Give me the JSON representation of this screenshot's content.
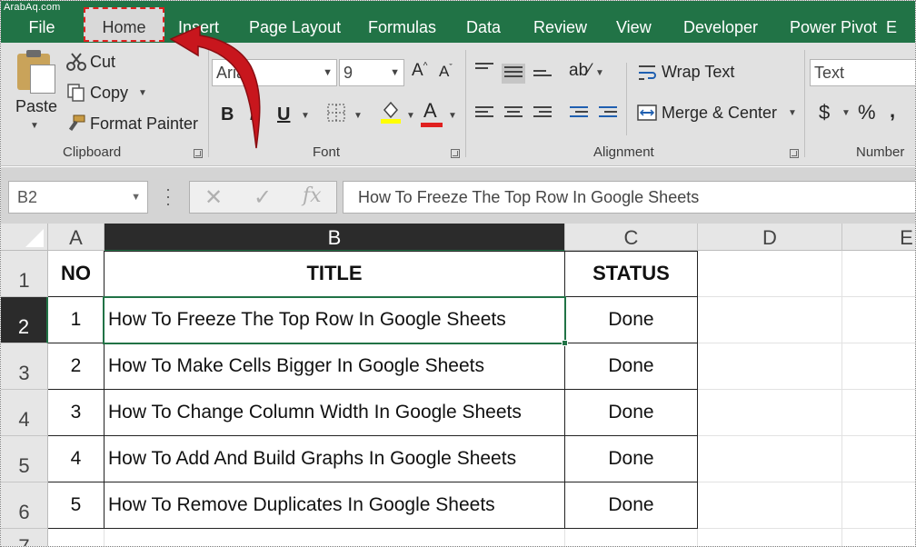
{
  "watermark": "ArabAq.com",
  "tabs": {
    "file": "File",
    "home": "Home",
    "insert": "Insert",
    "page_layout": "Page Layout",
    "formulas": "Formulas",
    "data": "Data",
    "review": "Review",
    "view": "View",
    "developer": "Developer",
    "power_pivot": "Power Pivot",
    "overflow": "E"
  },
  "ribbon": {
    "clipboard": {
      "label": "Clipboard",
      "paste": "Paste",
      "cut": "Cut",
      "copy": "Copy",
      "format_painter": "Format Painter"
    },
    "font": {
      "label": "Font",
      "font_name": "Arial",
      "font_size": "9",
      "bold": "B",
      "italic": "I",
      "underline": "U",
      "font_color_letter": "A"
    },
    "alignment": {
      "label": "Alignment",
      "wrap_text": "Wrap Text",
      "merge_center": "Merge & Center"
    },
    "number": {
      "label": "Number",
      "format": "Text",
      "currency": "$",
      "percent": "%"
    }
  },
  "formula_bar": {
    "name_box": "B2",
    "cancel": "✕",
    "enter": "✓",
    "fx": "fx",
    "content": "How To Freeze The Top Row In Google Sheets"
  },
  "grid": {
    "columns": [
      "A",
      "B",
      "C",
      "D",
      "E"
    ],
    "rows": [
      "1",
      "2",
      "3",
      "4",
      "5",
      "6",
      "7"
    ],
    "selected_column": "B",
    "selected_row": "2",
    "header": {
      "no": "NO",
      "title": "TITLE",
      "status": "STATUS"
    },
    "data": [
      {
        "no": "1",
        "title": "How To Freeze The Top Row In Google Sheets",
        "status": "Done"
      },
      {
        "no": "2",
        "title": "How To Make Cells Bigger In Google Sheets",
        "status": "Done"
      },
      {
        "no": "3",
        "title": "How To Change Column Width In Google Sheets",
        "status": "Done"
      },
      {
        "no": "4",
        "title": "How To Add And Build Graphs In Google Sheets",
        "status": "Done"
      },
      {
        "no": "5",
        "title": "How To Remove Duplicates In Google Sheets",
        "status": "Done"
      }
    ]
  },
  "colors": {
    "excel_green": "#217346",
    "annotation_red": "#c8161d"
  }
}
